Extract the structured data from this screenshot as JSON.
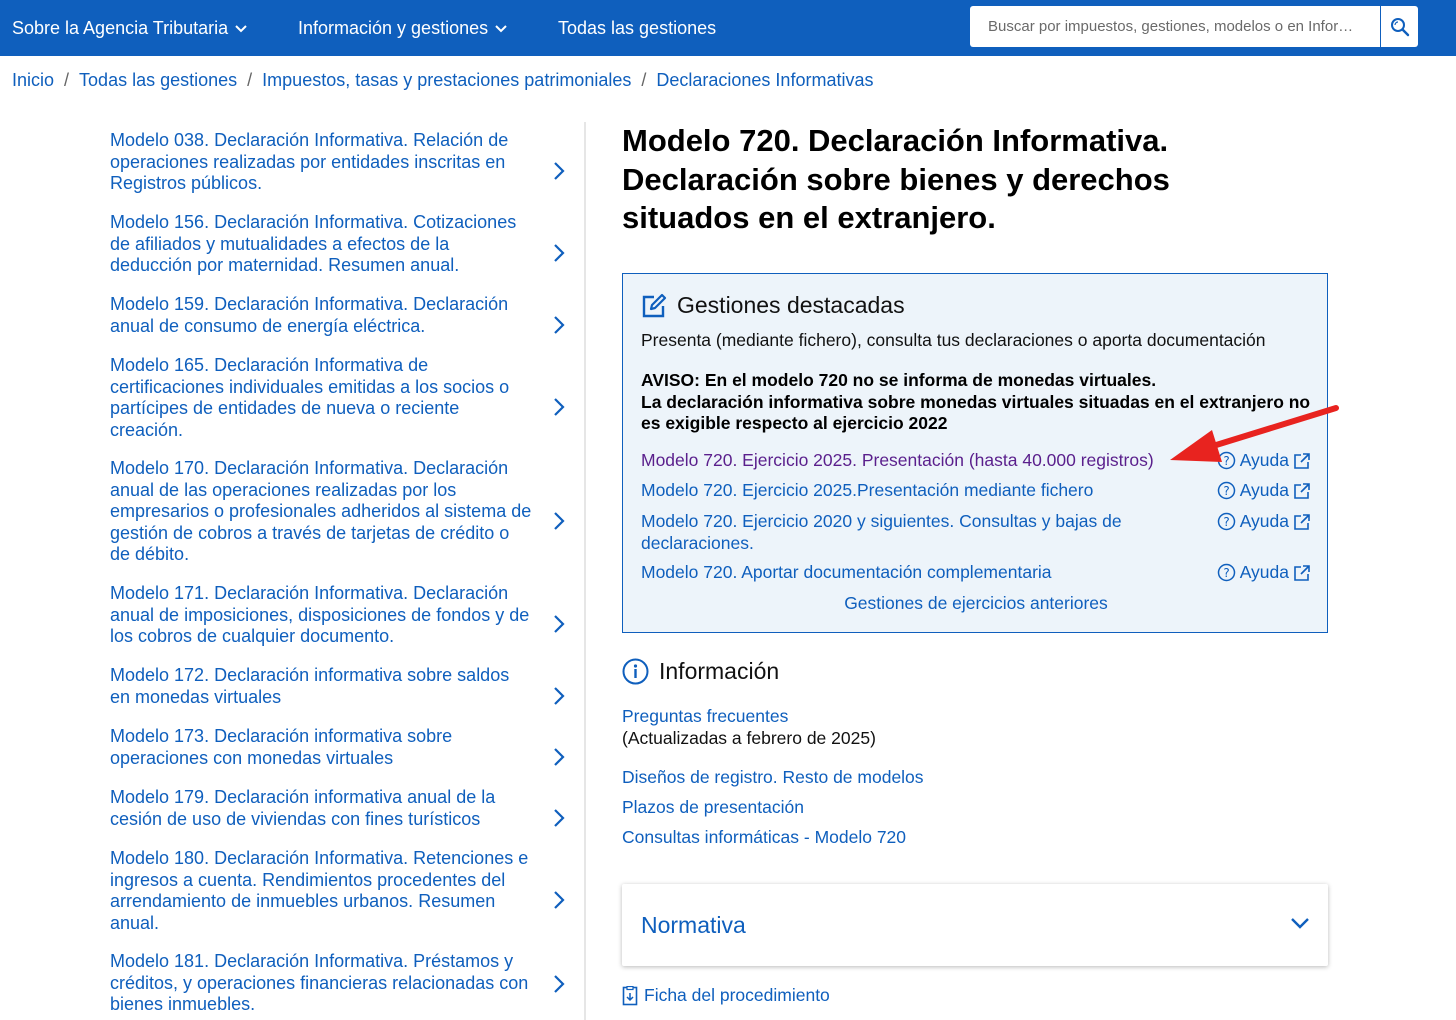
{
  "topnav": {
    "items": [
      {
        "label": "Sobre la Agencia Tributaria",
        "has_dropdown": true
      },
      {
        "label": "Información y gestiones",
        "has_dropdown": true
      },
      {
        "label": "Todas las gestiones",
        "has_dropdown": false
      }
    ],
    "search_placeholder": "Buscar por impuestos, gestiones, modelos o en Infor…",
    "search_icon": "search-icon",
    "background_color": "#0f5fbd"
  },
  "breadcrumb": {
    "items": [
      "Inicio",
      "Todas las gestiones",
      "Impuestos, tasas y prestaciones patrimoniales",
      "Declaraciones Informativas"
    ],
    "separator": "/"
  },
  "sidebar": {
    "items": [
      {
        "label": "Modelo 038. Declaración Informativa. Relación de operaciones realizadas por entidades inscritas en Registros públicos."
      },
      {
        "label": "Modelo 156. Declaración Informativa. Cotizaciones de afiliados y mutualidades a efectos de la deducción por maternidad. Resumen anual."
      },
      {
        "label": "Modelo 159. Declaración Informativa. Declaración anual de consumo de energía eléctrica."
      },
      {
        "label": "Modelo 165. Declaración Informativa de certificaciones individuales emitidas a los socios o partícipes de entidades de nueva o reciente creación."
      },
      {
        "label": "Modelo 170. Declaración Informativa. Declaración anual de las operaciones realizadas por los empresarios o profesionales adheridos al sistema de gestión de cobros a través de tarjetas de crédito o de débito."
      },
      {
        "label": "Modelo 171. Declaración Informativa. Declaración anual de imposiciones, disposiciones de fondos y de los cobros de cualquier documento."
      },
      {
        "label": "Modelo 172. Declaración informativa sobre saldos en monedas virtuales"
      },
      {
        "label": "Modelo 173. Declaración informativa sobre operaciones con monedas virtuales"
      },
      {
        "label": "Modelo 179. Declaración informativa anual de la cesión de uso de viviendas con fines turísticos"
      },
      {
        "label": "Modelo 180. Declaración Informativa. Retenciones e ingresos a cuenta. Rendimientos procedentes del arrendamiento de inmuebles urbanos. Resumen anual."
      },
      {
        "label": "Modelo 181. Declaración Informativa. Préstamos y créditos, y operaciones financieras relacionadas con bienes inmuebles."
      }
    ],
    "arrow_icon": "chevron-right-icon"
  },
  "main": {
    "title": "Modelo 720. Declaración Informativa. Declaración sobre bienes y derechos situados en el extranjero.",
    "gestiones": {
      "heading": "Gestiones destacadas",
      "heading_icon": "edit-icon",
      "subtitle": "Presenta (mediante fichero), consulta tus declaraciones o aporta documentación",
      "aviso_line1": "AVISO: En el modelo 720 no se informa de monedas virtuales.",
      "aviso_line2": "La declaración informativa sobre monedas virtuales situadas en el extranjero no es exigible respecto al ejercicio 2022",
      "procedures": [
        {
          "label": "Modelo 720. Ejercicio 2025. Presentación (hasta 40.000 registros)",
          "help": "Ayuda",
          "visited": true
        },
        {
          "label": "Modelo 720. Ejercicio 2025.Presentación mediante fichero",
          "help": "Ayuda",
          "visited": false
        },
        {
          "label": "Modelo 720. Ejercicio 2020 y siguientes. Consultas y bajas de declaraciones.",
          "help": "Ayuda",
          "visited": false
        },
        {
          "label": "Modelo 720. Aportar documentación complementaria",
          "help": "Ayuda",
          "visited": false
        }
      ],
      "previous_link": "Gestiones de ejercicios anteriores"
    },
    "informacion": {
      "heading": "Información",
      "heading_icon": "info-icon",
      "faq_link": "Preguntas frecuentes",
      "faq_note": "(Actualizadas a febrero de 2025)",
      "links": [
        "Diseños de registro. Resto de modelos",
        "Plazos de presentación",
        "Consultas informáticas - Modelo 720"
      ]
    },
    "normativa": {
      "label": "Normativa"
    },
    "ficha": {
      "label": "Ficha del procedimiento",
      "icon": "document-icon"
    }
  },
  "annotation": {
    "color": "#e8231f",
    "icon": "red-arrow-annotation"
  }
}
